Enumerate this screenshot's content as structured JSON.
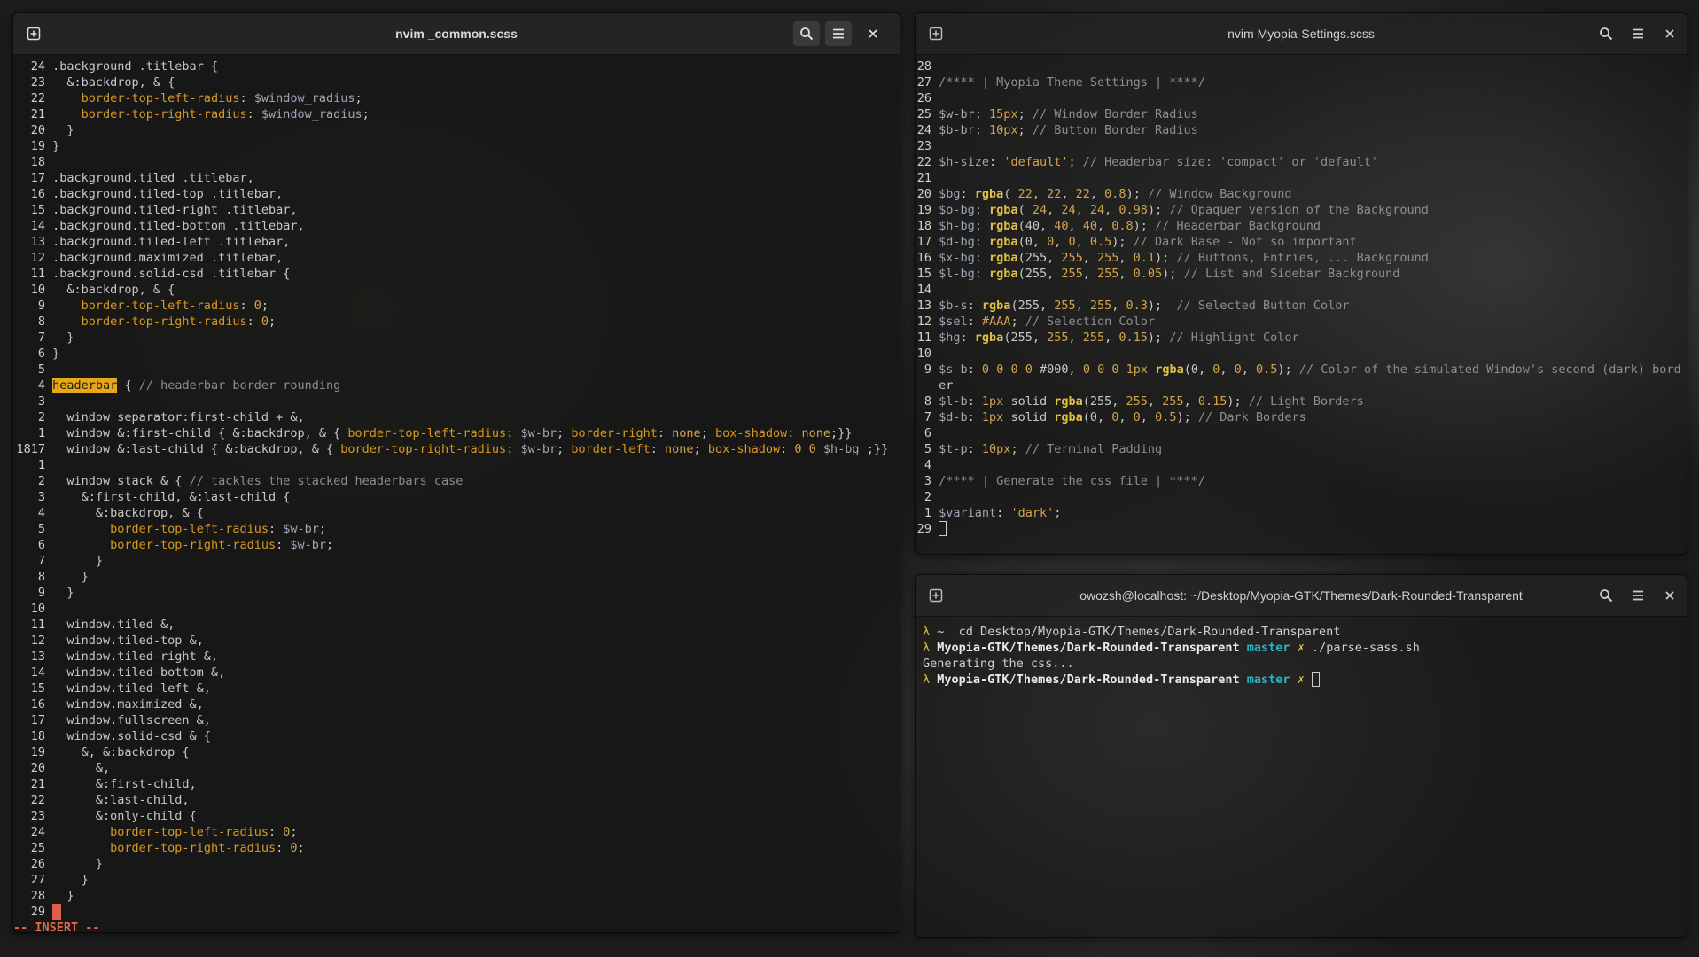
{
  "left": {
    "title": "nvim _common.scss",
    "mode": "-- INSERT --",
    "lines": [
      {
        "n": "24",
        "t": ".background .titlebar {"
      },
      {
        "n": "23",
        "t": "  &:backdrop, & {"
      },
      {
        "n": "22",
        "t": "    border-top-left-radius: $window_radius;"
      },
      {
        "n": "21",
        "t": "    border-top-right-radius: $window_radius;"
      },
      {
        "n": "20",
        "t": "  }"
      },
      {
        "n": "19",
        "t": "}"
      },
      {
        "n": "18",
        "t": ""
      },
      {
        "n": "17",
        "t": ".background.tiled .titlebar,"
      },
      {
        "n": "16",
        "t": ".background.tiled-top .titlebar,"
      },
      {
        "n": "15",
        "t": ".background.tiled-right .titlebar,"
      },
      {
        "n": "14",
        "t": ".background.tiled-bottom .titlebar,"
      },
      {
        "n": "13",
        "t": ".background.tiled-left .titlebar,"
      },
      {
        "n": "12",
        "t": ".background.maximized .titlebar,"
      },
      {
        "n": "11",
        "t": ".background.solid-csd .titlebar {"
      },
      {
        "n": "10",
        "t": "  &:backdrop, & {"
      },
      {
        "n": "9",
        "t": "    border-top-left-radius: 0;"
      },
      {
        "n": "8",
        "t": "    border-top-right-radius: 0;"
      },
      {
        "n": "7",
        "t": "  }"
      },
      {
        "n": "6",
        "t": "}"
      },
      {
        "n": "5",
        "t": ""
      },
      {
        "n": "4",
        "t": "headerbar { // headerbar border rounding"
      },
      {
        "n": "3",
        "t": ""
      },
      {
        "n": "2",
        "t": "  window separator:first-child + &,"
      },
      {
        "n": "1",
        "t": "  window &:first-child { &:backdrop, & { border-top-left-radius: $w-br; border-right: none; box-shadow: none;}}"
      },
      {
        "n": "1817",
        "t": "  window &:last-child { &:backdrop, & { border-top-right-radius: $w-br; border-left: none; box-shadow: 0 0 $h-bg ;}}"
      },
      {
        "n": "1",
        "t": ""
      },
      {
        "n": "2",
        "t": "  window stack & { // tackles the stacked headerbars case"
      },
      {
        "n": "3",
        "t": "    &:first-child, &:last-child {"
      },
      {
        "n": "4",
        "t": "      &:backdrop, & {"
      },
      {
        "n": "5",
        "t": "        border-top-left-radius: $w-br;"
      },
      {
        "n": "6",
        "t": "        border-top-right-radius: $w-br;"
      },
      {
        "n": "7",
        "t": "      }"
      },
      {
        "n": "8",
        "t": "    }"
      },
      {
        "n": "9",
        "t": "  }"
      },
      {
        "n": "10",
        "t": ""
      },
      {
        "n": "11",
        "t": "  window.tiled &,"
      },
      {
        "n": "12",
        "t": "  window.tiled-top &,"
      },
      {
        "n": "13",
        "t": "  window.tiled-right &,"
      },
      {
        "n": "14",
        "t": "  window.tiled-bottom &,"
      },
      {
        "n": "15",
        "t": "  window.tiled-left &,"
      },
      {
        "n": "16",
        "t": "  window.maximized &,"
      },
      {
        "n": "17",
        "t": "  window.fullscreen &,"
      },
      {
        "n": "18",
        "t": "  window.solid-csd & {"
      },
      {
        "n": "19",
        "t": "    &, &:backdrop {"
      },
      {
        "n": "20",
        "t": "      &,"
      },
      {
        "n": "21",
        "t": "      &:first-child,"
      },
      {
        "n": "22",
        "t": "      &:last-child,"
      },
      {
        "n": "23",
        "t": "      &:only-child {"
      },
      {
        "n": "24",
        "t": "        border-top-left-radius: 0;"
      },
      {
        "n": "25",
        "t": "        border-top-right-radius: 0;"
      },
      {
        "n": "26",
        "t": "      }"
      },
      {
        "n": "27",
        "t": "    }"
      },
      {
        "n": "28",
        "t": "  }"
      },
      {
        "n": "29",
        "t": "}"
      }
    ]
  },
  "right_top": {
    "title": "nvim Myopia-Settings.scss",
    "lines": [
      {
        "n": "28",
        "t": ""
      },
      {
        "n": "27",
        "t": "/**** | Myopia Theme Settings | ****/"
      },
      {
        "n": "26",
        "t": ""
      },
      {
        "n": "25",
        "t": "$w-br: 15px; // Window Border Radius"
      },
      {
        "n": "24",
        "t": "$b-br: 10px; // Button Border Radius"
      },
      {
        "n": "23",
        "t": ""
      },
      {
        "n": "22",
        "t": "$h-size: 'default'; // Headerbar size: 'compact' or 'default'"
      },
      {
        "n": "21",
        "t": ""
      },
      {
        "n": "20",
        "t": "$bg: rgba( 22, 22, 22, 0.8); // Window Background"
      },
      {
        "n": "19",
        "t": "$o-bg: rgba( 24, 24, 24, 0.98); // Opaquer version of the Background"
      },
      {
        "n": "18",
        "t": "$h-bg: rgba(40, 40, 40, 0.8); // Headerbar Background"
      },
      {
        "n": "17",
        "t": "$d-bg: rgba(0, 0, 0, 0.5); // Dark Base - Not so important"
      },
      {
        "n": "16",
        "t": "$x-bg: rgba(255, 255, 255, 0.1); // Buttons, Entries, ... Background"
      },
      {
        "n": "15",
        "t": "$l-bg: rgba(255, 255, 255, 0.05); // List and Sidebar Background"
      },
      {
        "n": "14",
        "t": ""
      },
      {
        "n": "13",
        "t": "$b-s: rgba(255, 255, 255, 0.3);  // Selected Button Color"
      },
      {
        "n": "12",
        "t": "$sel: #AAA; // Selection Color"
      },
      {
        "n": "11",
        "t": "$hg: rgba(255, 255, 255, 0.15); // Highlight Color"
      },
      {
        "n": "10",
        "t": ""
      },
      {
        "n": "9",
        "t": "$s-b: 0 0 0 0 #000, 0 0 0 1px rgba(0, 0, 0, 0.5); // Color of the simulated Window's second (dark) bord"
      },
      {
        "n": "",
        "t": "er"
      },
      {
        "n": "8",
        "t": "$l-b: 1px solid rgba(255, 255, 255, 0.15); // Light Borders"
      },
      {
        "n": "7",
        "t": "$d-b: 1px solid rgba(0, 0, 0, 0.5); // Dark Borders"
      },
      {
        "n": "6",
        "t": ""
      },
      {
        "n": "5",
        "t": "$t-p: 10px; // Terminal Padding"
      },
      {
        "n": "4",
        "t": ""
      },
      {
        "n": "3",
        "t": "/**** | Generate the css file | ****/"
      },
      {
        "n": "2",
        "t": ""
      },
      {
        "n": "1",
        "t": "$variant: 'dark';"
      },
      {
        "n": "29",
        "t": ""
      }
    ]
  },
  "terminal": {
    "title": "owozsh@localhost: ~/Desktop/Myopia-GTK/Themes/Dark-Rounded-Transparent",
    "prompt": "λ",
    "line1_cmd": " ~  cd Desktop/Myopia-GTK/Themes/Dark-Rounded-Transparent",
    "path": "Myopia-GTK/Themes/Dark-Rounded-Transparent",
    "branch": "master",
    "dirty": "✗",
    "line2_cmd": "./parse-sass.sh",
    "output": "Generating the css..."
  },
  "colors": {
    "accent_highlight": "#e6a817",
    "branch": "#27b5c4",
    "prompt": "#e0c040",
    "insert_mode": "#e36b4a"
  },
  "icons": [
    "new-tab-icon",
    "search-icon",
    "menu-icon",
    "close-icon"
  ]
}
